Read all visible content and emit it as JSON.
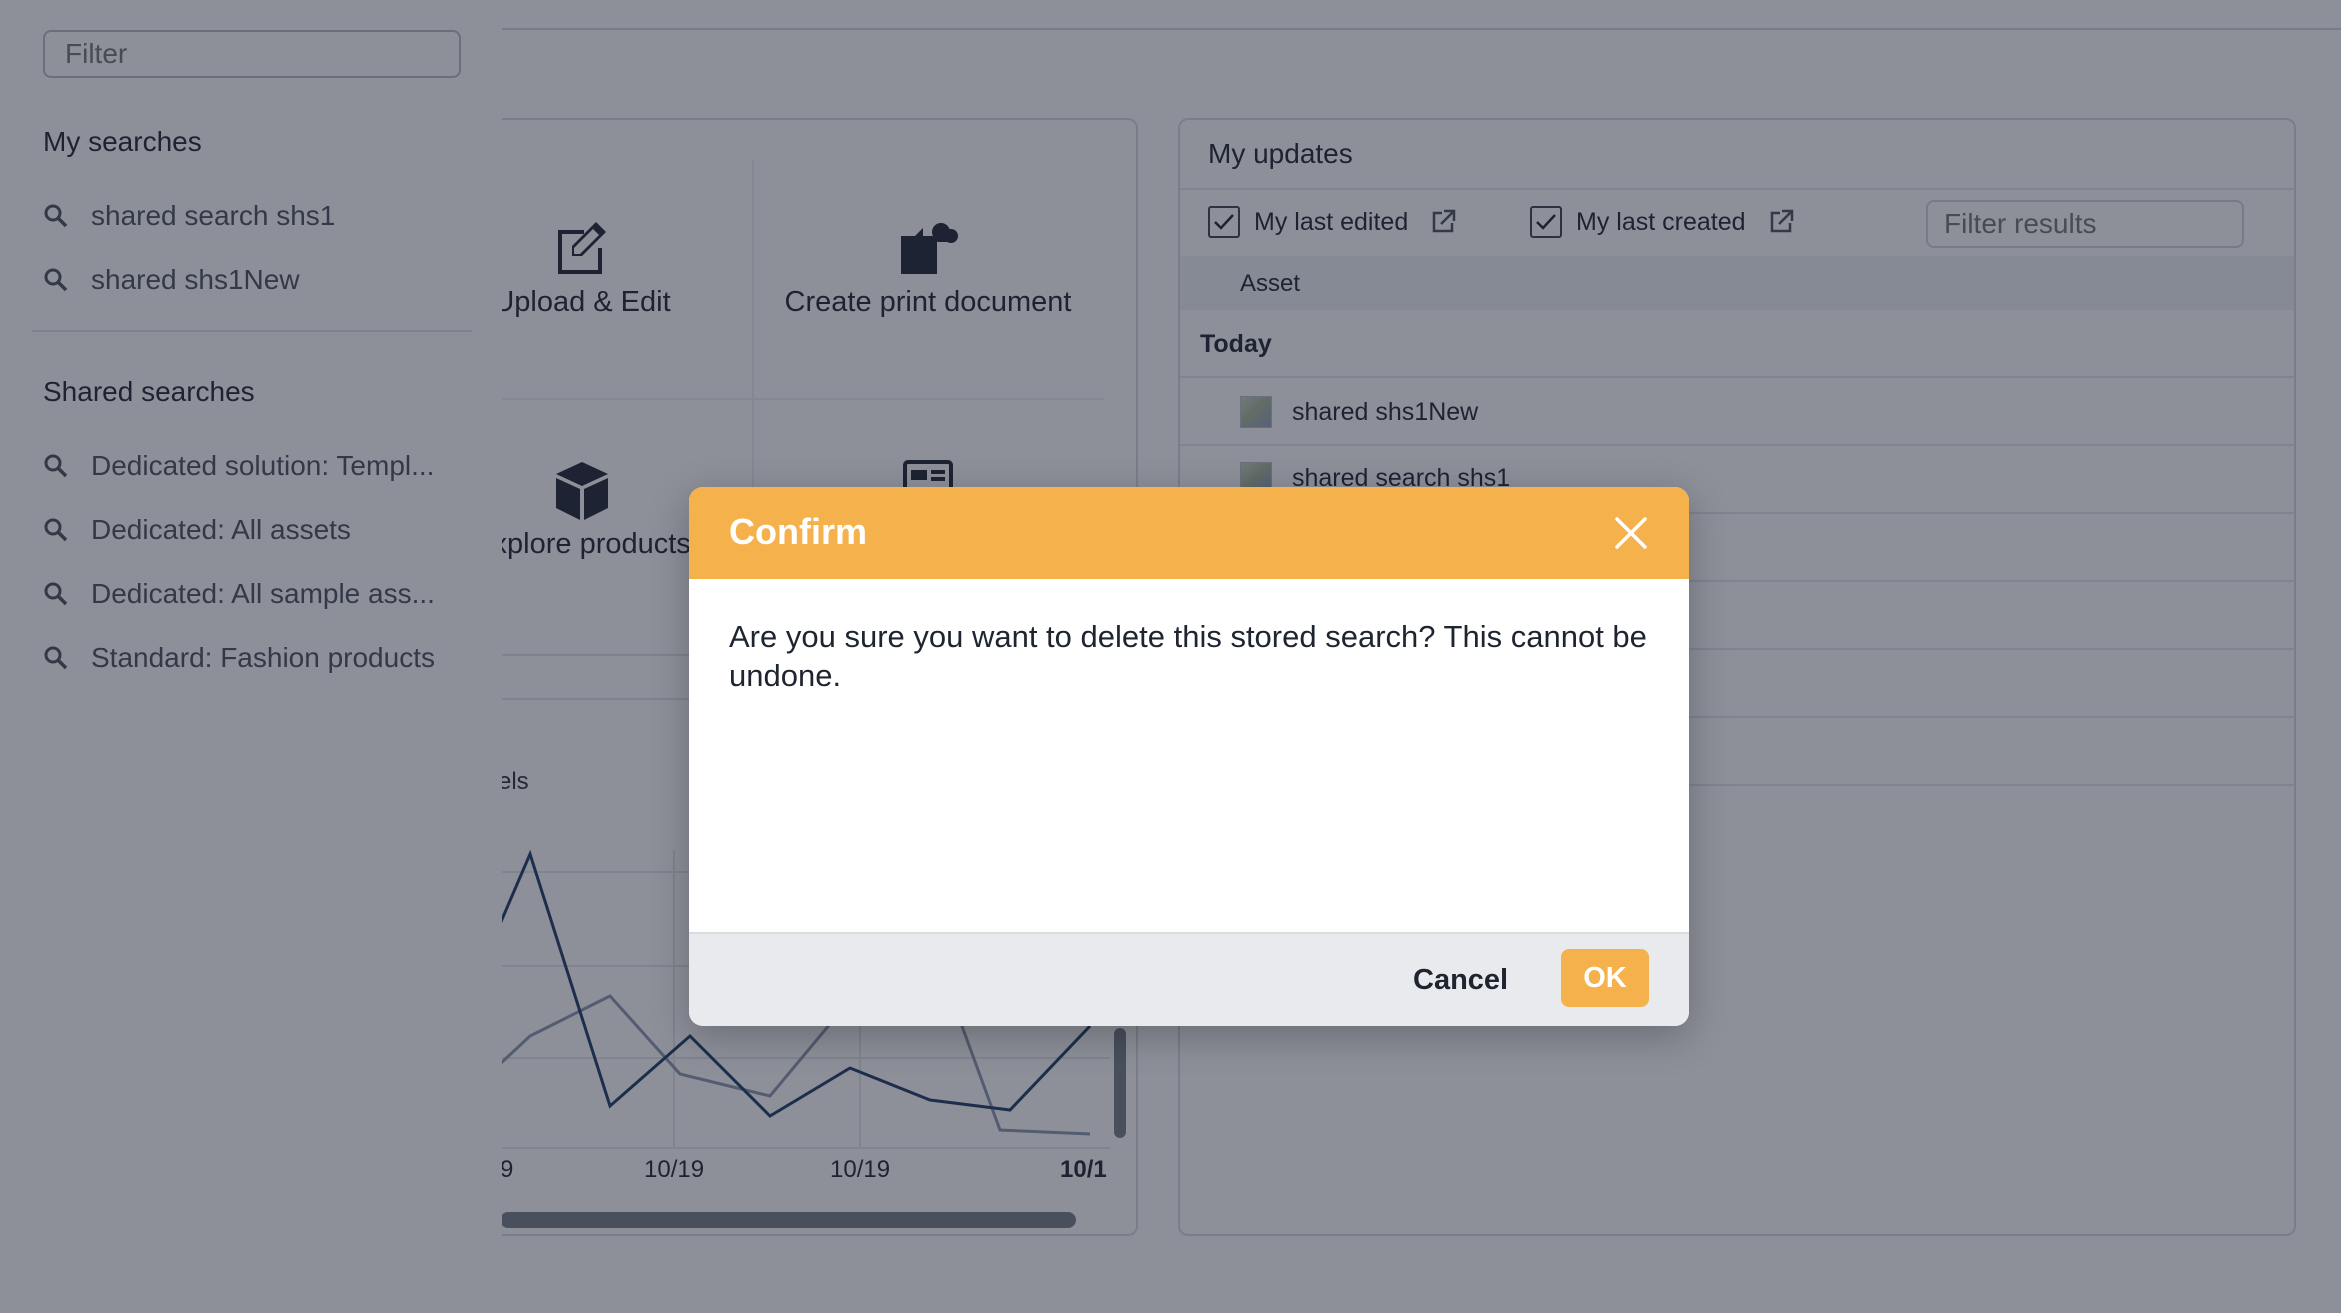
{
  "sidebar": {
    "filter_placeholder": "Filter",
    "my_searches_heading": "My searches",
    "my_searches": [
      {
        "label": "shared search shs1",
        "icon": "search-icon"
      },
      {
        "label": "shared shs1New",
        "icon": "search-icon"
      }
    ],
    "shared_searches_heading": "Shared searches",
    "shared_searches": [
      {
        "label": "Dedicated solution: Templ...",
        "icon": "search-icon"
      },
      {
        "label": "Dedicated: All assets",
        "icon": "search-icon"
      },
      {
        "label": "Dedicated: All sample ass...",
        "icon": "search-icon"
      },
      {
        "label": "Standard: Fashion products",
        "icon": "search-icon"
      }
    ]
  },
  "quick_actions": {
    "tiles": [
      {
        "label": "Upload & Edit",
        "icon": "edit-icon"
      },
      {
        "label": "Create print document",
        "icon": "print-document-icon"
      },
      {
        "label": "Explore products",
        "icon": "cube-icon"
      },
      {
        "label": "",
        "icon": "layout-icon"
      }
    ]
  },
  "chart": {
    "legend_fragment": "els",
    "ticks": [
      "9",
      "10/19",
      "10/19",
      "10/1"
    ]
  },
  "my_updates": {
    "title": "My updates",
    "last_edited_label": "My last edited",
    "last_created_label": "My last created",
    "filter_placeholder": "Filter results",
    "column_asset": "Asset",
    "group_today": "Today",
    "rows": [
      "shared shs1New",
      "shared search shs1"
    ]
  },
  "dialog": {
    "title": "Confirm",
    "message": "Are you sure you want to delete this stored search? This cannot be undone.",
    "cancel_label": "Cancel",
    "ok_label": "OK"
  },
  "colors": {
    "accent": "#f5b24c",
    "overlay": "#1b2233",
    "chart_line_dark": "#1f3a66",
    "chart_line_light": "#8a97ad"
  }
}
